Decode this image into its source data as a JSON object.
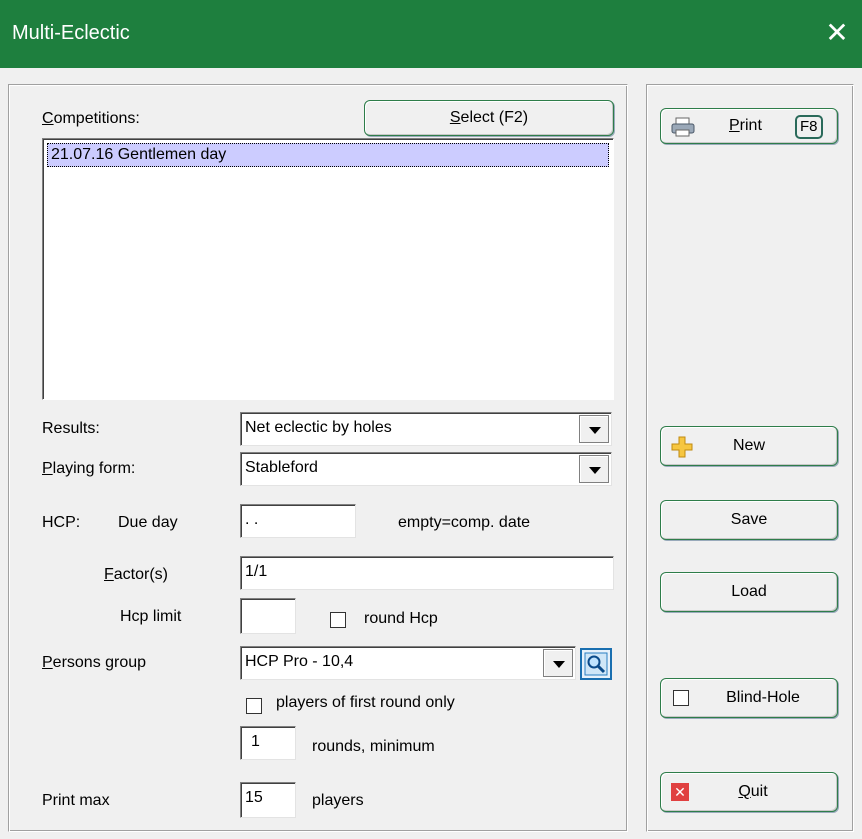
{
  "window": {
    "title": "Multi-Eclectic",
    "close_glyph": "✕"
  },
  "competitions": {
    "label_first": "C",
    "label_rest": "ompetitions:",
    "select_button_first": "S",
    "select_button_rest": "elect (F2)",
    "items": [
      "21.07.16 Gentlemen day"
    ]
  },
  "results": {
    "label": "Results:",
    "value": "Net eclectic by holes"
  },
  "playing_form": {
    "label_first": "P",
    "label_rest": "laying form:",
    "value": "Stableford"
  },
  "hcp": {
    "label": "HCP:",
    "due_day_label": "Due day",
    "due_day_value": " .  .",
    "due_day_hint": "empty=comp. date",
    "factor_label_first": "F",
    "factor_label_rest": "actor(s)",
    "factor_value": "1/1",
    "limit_label": "Hcp limit",
    "limit_value": "",
    "round_hcp_label": "round Hcp"
  },
  "persons_group": {
    "label_first": "P",
    "label_rest": "ersons group",
    "value": "HCP Pro - 10,4",
    "first_round_only_label": "players of first round only",
    "rounds_min_value": "1",
    "rounds_min_label": "rounds, minimum"
  },
  "print_max": {
    "label": "Print max",
    "value": "15",
    "suffix": "players"
  },
  "side": {
    "print_first": "P",
    "print_rest": "rint",
    "print_key": "F8",
    "new_label": "New",
    "save_label": "Save",
    "load_label": "Load",
    "blind_hole_label": "Blind-Hole",
    "quit_first": "Q",
    "quit_rest": "uit"
  },
  "colors": {
    "titlebar": "#1e7f3e",
    "selection": "#ccccff",
    "button_border": "#2e7d4a"
  }
}
